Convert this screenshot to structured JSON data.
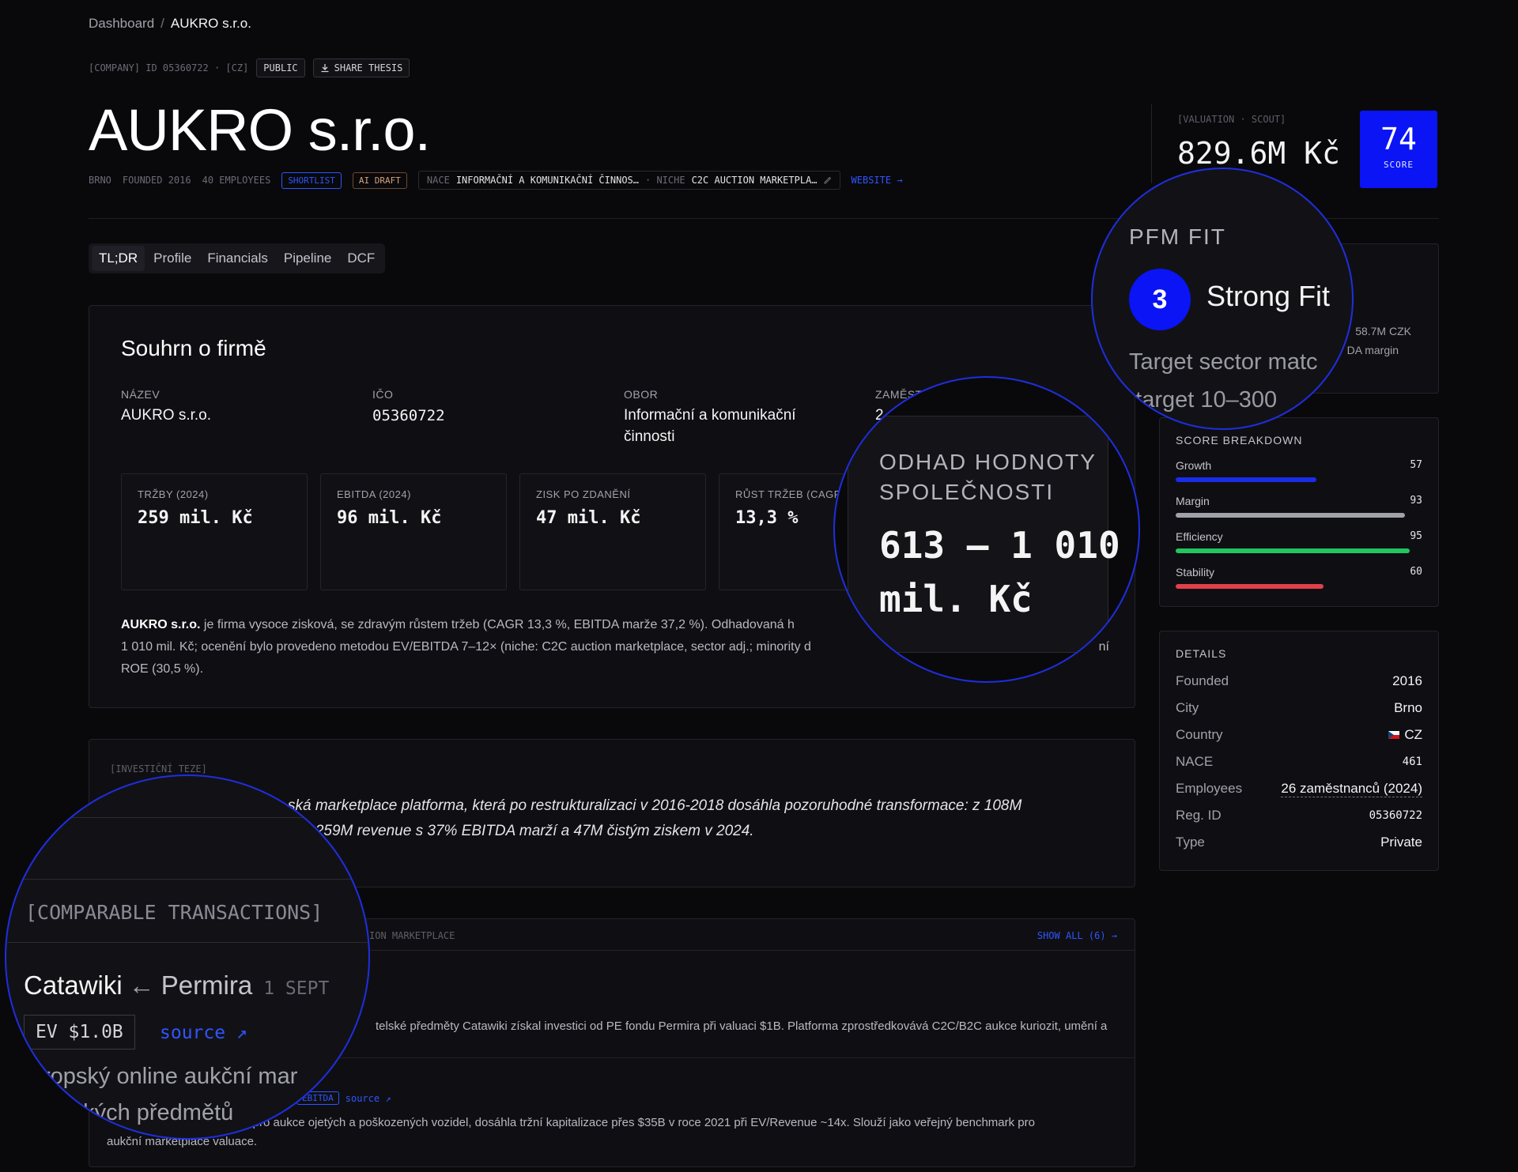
{
  "breadcrumb": {
    "root": "Dashboard",
    "sep": "/",
    "current": "AUKRO s.r.o."
  },
  "meta": {
    "id_text": "[COMPANY] ID 05360722 · [CZ]",
    "public_label": "PUBLIC",
    "share_label": "SHARE THESIS"
  },
  "company": {
    "name": "AUKRO s.r.o.",
    "city": "BRNO",
    "founded": "FOUNDED 2016",
    "employees": "40 EMPLOYEES",
    "shortlist": "SHORTLIST",
    "ai_draft": "AI DRAFT",
    "nace_label": "NACE",
    "nace_value": "INFORMAČNÍ A KOMUNIKAČNÍ ČINNOS…",
    "niche_label": "· NICHE",
    "niche_value": "C2C AUCTION MARKETPLA…",
    "website": "WEBSITE →"
  },
  "tabs": [
    "TL;DR",
    "Profile",
    "Financials",
    "Pipeline",
    "DCF"
  ],
  "summary": {
    "title": "Souhrn o firmě",
    "facts": [
      {
        "label": "NÁZEV",
        "value": "AUKRO s.r.o."
      },
      {
        "label": "IČO",
        "value": "05360722"
      },
      {
        "label": "OBOR",
        "value": "Informační a komunikační činnosti"
      },
      {
        "label": "ZAMĚST",
        "value": "2"
      }
    ],
    "metrics": [
      {
        "label": "TRŽBY (2024)",
        "value": "259 mil. Kč"
      },
      {
        "label": "EBITDA (2024)",
        "value": "96 mil. Kč"
      },
      {
        "label": "ZISK PO ZDANĚNÍ",
        "value": "47 mil. Kč"
      },
      {
        "label": "RŮST TRŽEB (CAGR",
        "value": "13,3 %"
      }
    ],
    "text_company": "AUKRO s.r.o.",
    "text_line1": " je firma vysoce zisková, se zdravým růstem tržeb (CAGR 13,3 %, EBITDA marže 37,2 %). Odhadovaná h",
    "text_line2": "1 010 mil. Kč; ocenění bylo provedeno metodou EV/EBITDA 7–12× (niche: C2C auction marketplace, sector adj.; minority d",
    "text_line2_end": "ní",
    "text_line3": "ROE (30,5 %)."
  },
  "valuation_lens": {
    "label_line1": "ODHAD HODNOTY",
    "label_line2": "SPOLEČNOSTI",
    "value_line1": "613 – 1 010",
    "value_line2": "mil. Kč"
  },
  "thesis": {
    "label": "[INVESTIČNÍ TEZE]",
    "line1": "ská marketplace platforma, která po restrukturalizaci v 2016-2018 dosáhla pozoruhodné transformace: z 108M",
    "line2": "a 259M revenue s 37% EBITDA marží a 47M čistým ziskem v 2024."
  },
  "comps": {
    "header": "ION MARKETPLACE",
    "show_all": "SHOW ALL (6) →",
    "row1_desc": "telské předměty Catawiki získal investici od PE fondu Permira při valuaci $1B. Platforma zprostředkovává C2C/B2C aukce kuriozit, umění a",
    "row2_tag": "EBITDA",
    "row2_source": "source ↗",
    "row2_desc_line1": "tforma pro aukce ojetých a poškozených vozidel, dosáhla tržní kapitalizace přes $35B v roce 2021 při EV/Revenue ~14x. Slouží jako veřejný benchmark pro",
    "row2_desc_line2": "aukční marketplace valuace."
  },
  "comps_lens": {
    "title": "[COMPARABLE TRANSACTIONS]",
    "target": "Catawiki",
    "arrow": "←",
    "acquirer": "Permira",
    "date": "1 SEPT",
    "ev": "EV $1.0B",
    "source": "source ↗",
    "line1": "ropský online aukční mar",
    "line2": "elských předmětů"
  },
  "valuation": {
    "label": "[VALUATION · SCOUT]",
    "value": "829.6M Kč"
  },
  "score": {
    "value": "74",
    "label": "SCORE"
  },
  "pfm": {
    "title": "PFM FIT",
    "number": "3",
    "fit": "Strong Fit",
    "line1": "Target sector matc",
    "line2": "n target 10–300",
    "peek1": "58.7M CZK",
    "peek2": "DA margin"
  },
  "breakdown": {
    "title": "SCORE BREAKDOWN",
    "items": [
      {
        "label": "Growth",
        "value": "57",
        "fraction": 0.57,
        "color": "#1a2ce8"
      },
      {
        "label": "Margin",
        "value": "93",
        "fraction": 0.93,
        "color": "#a1a1aa"
      },
      {
        "label": "Efficiency",
        "value": "95",
        "fraction": 0.95,
        "color": "#22c55e"
      },
      {
        "label": "Stability",
        "value": "60",
        "fraction": 0.6,
        "color": "#e0404a"
      }
    ]
  },
  "details": {
    "title": "DETAILS",
    "rows": [
      {
        "label": "Founded",
        "value": "2016"
      },
      {
        "label": "City",
        "value": "Brno"
      },
      {
        "label": "Country",
        "value": "CZ"
      },
      {
        "label": "NACE",
        "value": "461"
      },
      {
        "label": "Employees",
        "value": "26 zaměstnanců (2024)"
      },
      {
        "label": "Reg. ID",
        "value": "05360722"
      },
      {
        "label": "Type",
        "value": "Private"
      }
    ]
  }
}
